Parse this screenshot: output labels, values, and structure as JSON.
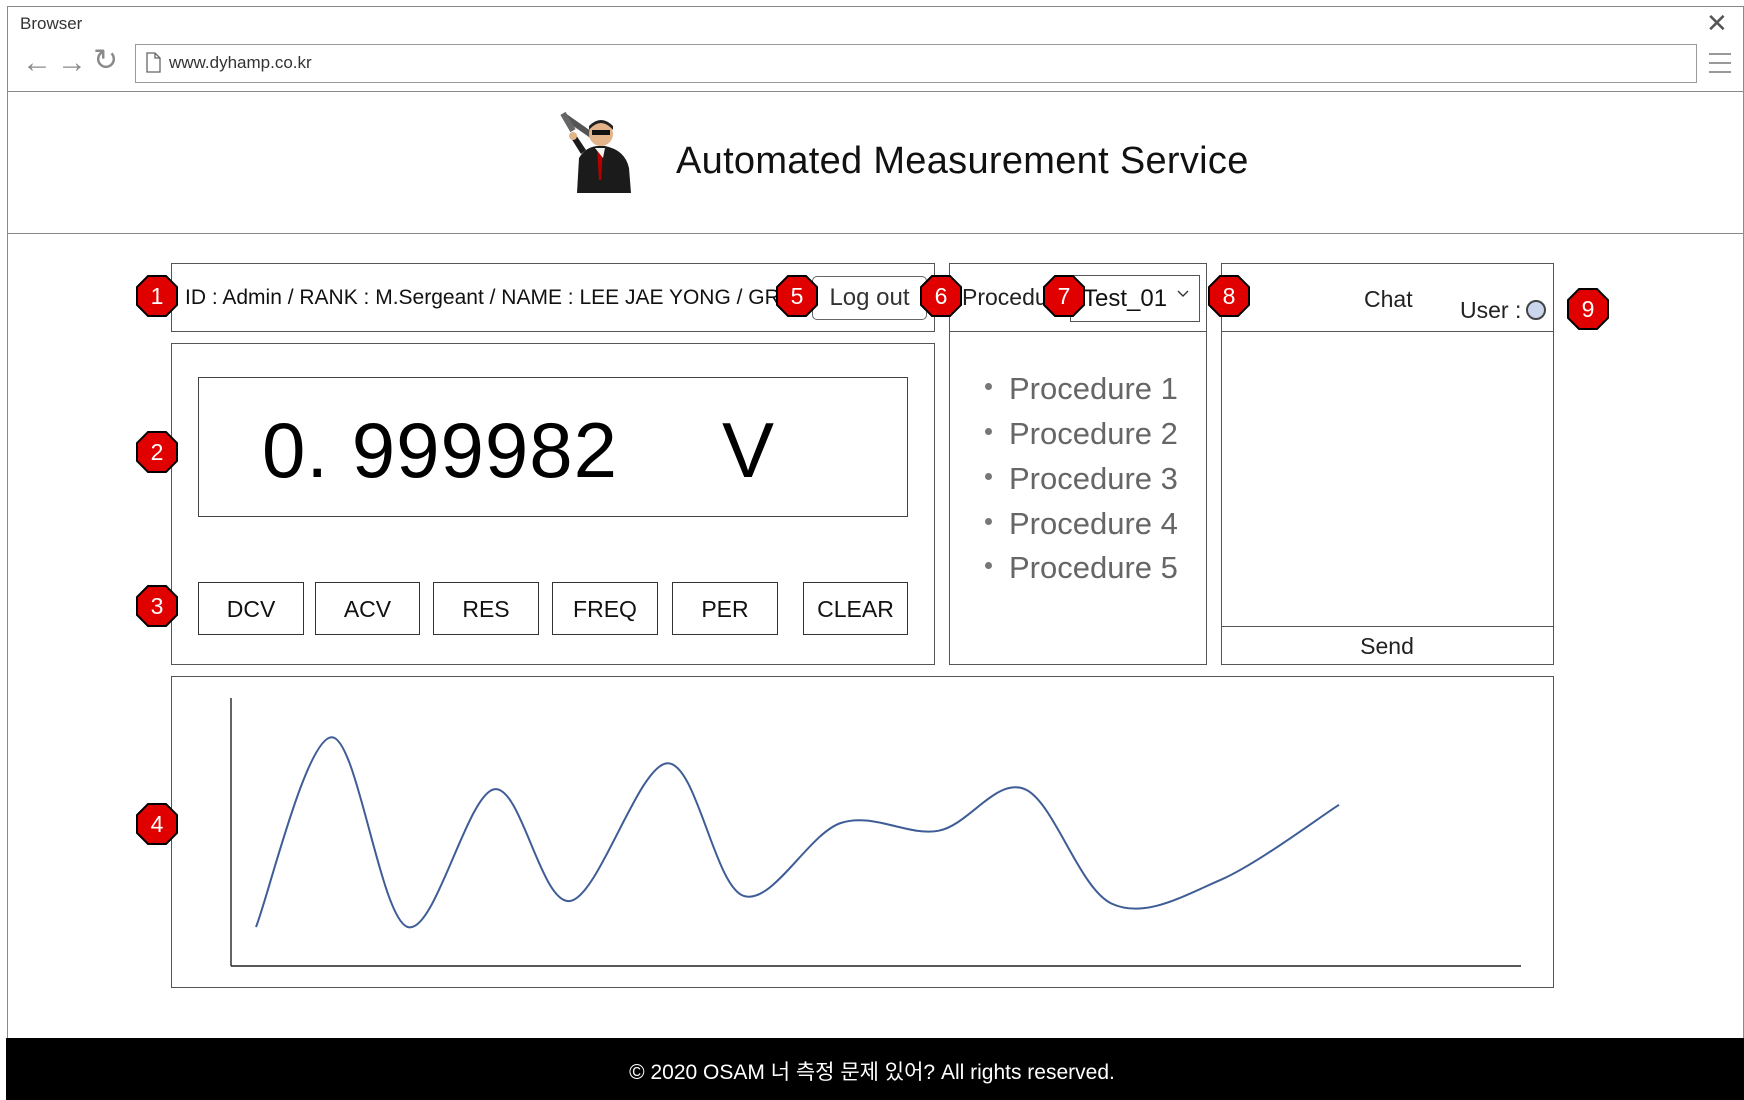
{
  "browser": {
    "label": "Browser",
    "url": "www.dyhamp.co.kr",
    "close": "✕",
    "back": "←",
    "forward": "→",
    "reload": "↻"
  },
  "header": {
    "title": "Automated Measurement Service",
    "logo_icon": "agent-with-gun-logo"
  },
  "user_bar": {
    "info": "ID : Admin / RANK : M.Sergeant / NAME : LEE JAE YONG / GROUP : PM",
    "logout_label": "Log out"
  },
  "procedure": {
    "label": "Procedure",
    "selected": "Test_01",
    "items": [
      "Procedure 1",
      "Procedure 2",
      "Procedure 3",
      "Procedure 4",
      "Procedure 5"
    ]
  },
  "meter": {
    "reading": "0. 999982",
    "unit": "V",
    "buttons": [
      "DCV",
      "ACV",
      "RES",
      "FREQ",
      "PER",
      "CLEAR"
    ]
  },
  "chat": {
    "title": "Chat",
    "user_label": "User :",
    "status_color": "#c9d6ec",
    "send_label": "Send"
  },
  "badges": [
    "1",
    "2",
    "3",
    "4",
    "5",
    "6",
    "7",
    "8",
    "9"
  ],
  "badge_color": "#e00000",
  "footer": {
    "text": "© 2020 OSAM 너 측정 문제 있어? All rights reserved."
  },
  "chart_data": {
    "type": "line",
    "title": "",
    "xlabel": "",
    "ylabel": "",
    "series": [
      {
        "color": "#3e5d96",
        "x": [
          0,
          0.07,
          0.14,
          0.22,
          0.29,
          0.38,
          0.45,
          0.54,
          0.63,
          0.71,
          0.79,
          0.89,
          1.0
        ],
        "values": [
          0.15,
          0.88,
          0.15,
          0.68,
          0.25,
          0.78,
          0.27,
          0.55,
          0.52,
          0.68,
          0.24,
          0.33,
          0.62
        ]
      }
    ]
  }
}
